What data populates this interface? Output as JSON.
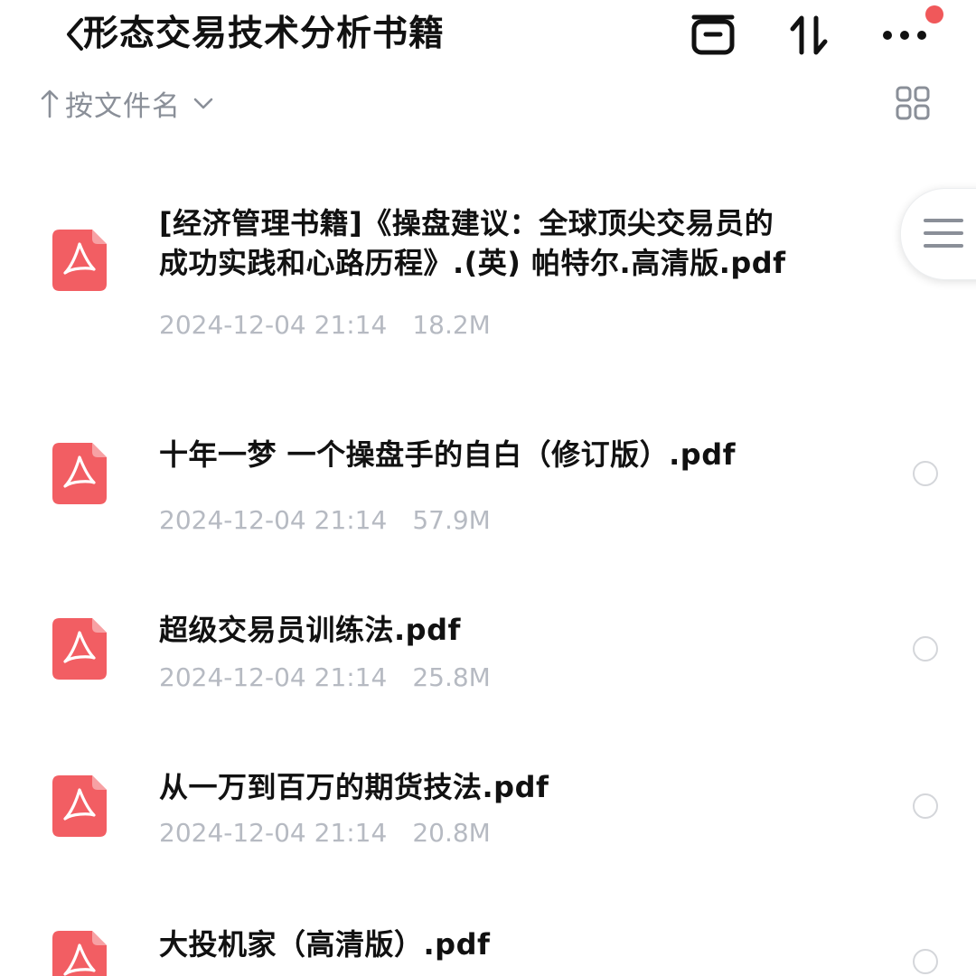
{
  "header": {
    "title": "形态交易技术分析书籍",
    "back_icon": "chevron-left-icon",
    "actions": [
      {
        "icon": "tray-icon"
      },
      {
        "icon": "sort-arrows-icon"
      },
      {
        "icon": "more-dots-icon"
      }
    ],
    "notification_color": "#f0585a"
  },
  "toolbar": {
    "sort_label": "按文件名",
    "sort_direction_icon": "arrow-up-icon",
    "sort_dropdown_icon": "chevron-down-icon",
    "view_toggle_icon": "grid-view-icon"
  },
  "files": [
    {
      "name_lines": [
        "[经济管理书籍]《操盘建议：全球顶尖交易员的",
        "成功实践和心路历程》.(英) 帕特尔.高清版.pdf"
      ],
      "date": "2024-12-04 21:14",
      "size": "18.2M",
      "icon": "pdf-file-icon"
    },
    {
      "name_lines": [
        "十年一梦 一个操盘手的自白（修订版）.pdf"
      ],
      "date": "2024-12-04 21:14",
      "size": "57.9M",
      "icon": "pdf-file-icon"
    },
    {
      "name_lines": [
        "超级交易员训练法.pdf"
      ],
      "date": "2024-12-04 21:14",
      "size": "25.8M",
      "icon": "pdf-file-icon"
    },
    {
      "name_lines": [
        "从一万到百万的期货技法.pdf"
      ],
      "date": "2024-12-04 21:14",
      "size": "20.8M",
      "icon": "pdf-file-icon"
    },
    {
      "name_lines": [
        "大投机家（高清版）.pdf"
      ],
      "date": "",
      "size": "",
      "icon": "pdf-file-icon"
    }
  ],
  "side_menu": {
    "icon": "menu-lines-icon"
  },
  "colors": {
    "pdf_icon": "#f25e63",
    "text_primary": "#111111",
    "text_secondary": "#b6bac2",
    "sort_label": "#8a8f98"
  }
}
